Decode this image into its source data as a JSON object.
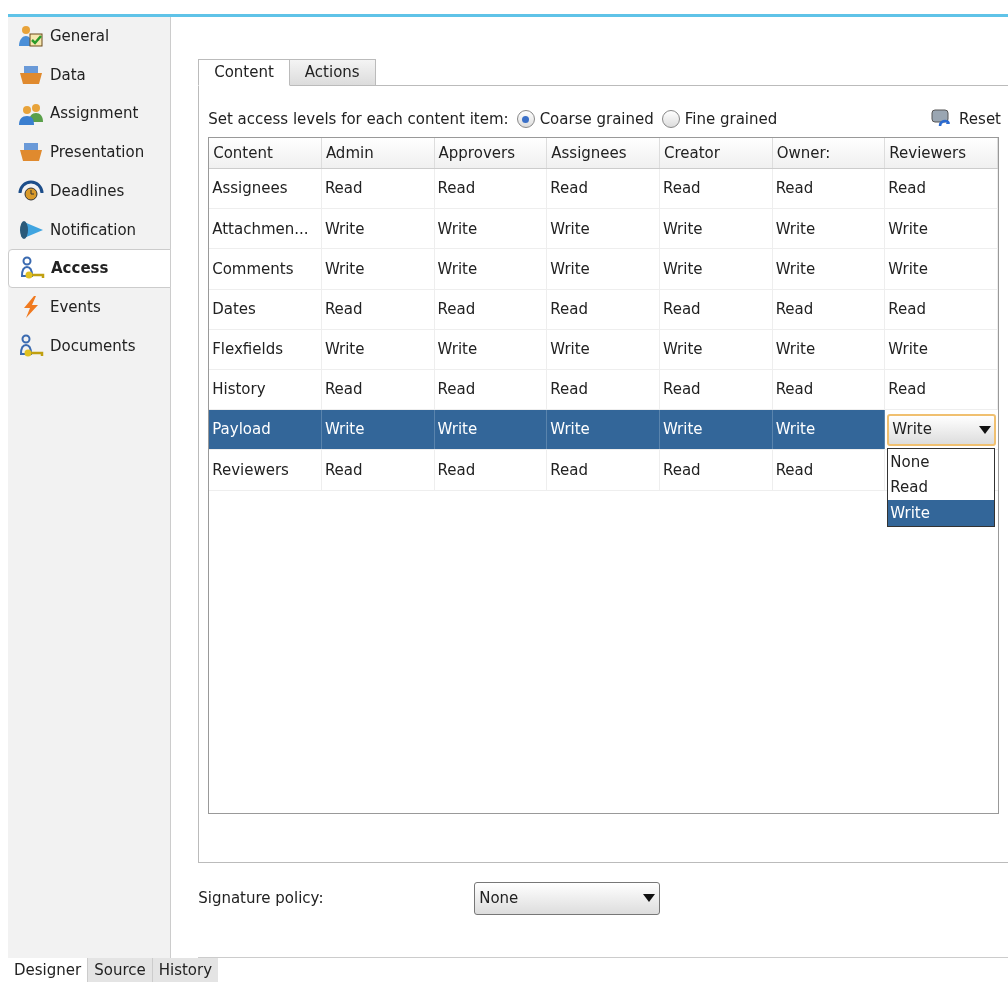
{
  "sidebar": {
    "items": [
      {
        "label": "General",
        "selected": false
      },
      {
        "label": "Data",
        "selected": false
      },
      {
        "label": "Assignment",
        "selected": false
      },
      {
        "label": "Presentation",
        "selected": false
      },
      {
        "label": "Deadlines",
        "selected": false
      },
      {
        "label": "Notification",
        "selected": false
      },
      {
        "label": "Access",
        "selected": true
      },
      {
        "label": "Events",
        "selected": false
      },
      {
        "label": "Documents",
        "selected": false
      }
    ]
  },
  "tabs": [
    {
      "label": "Content",
      "selected": true
    },
    {
      "label": "Actions",
      "selected": false
    }
  ],
  "access_levels": {
    "label": "Set access levels for each content item:",
    "options": [
      {
        "label": "Coarse grained",
        "selected": true
      },
      {
        "label": "Fine grained",
        "selected": false
      }
    ]
  },
  "reset_button": "Reset",
  "table": {
    "columns": [
      "Content",
      "Admin",
      "Approvers",
      "Assignees",
      "Creator",
      "Owner:",
      "Reviewers"
    ],
    "rows": [
      {
        "selected": false,
        "cells": [
          "Assignees",
          "Read",
          "Read",
          "Read",
          "Read",
          "Read",
          "Read"
        ]
      },
      {
        "selected": false,
        "cells": [
          "Attachmen...",
          "Write",
          "Write",
          "Write",
          "Write",
          "Write",
          "Write"
        ]
      },
      {
        "selected": false,
        "cells": [
          "Comments",
          "Write",
          "Write",
          "Write",
          "Write",
          "Write",
          "Write"
        ]
      },
      {
        "selected": false,
        "cells": [
          "Dates",
          "Read",
          "Read",
          "Read",
          "Read",
          "Read",
          "Read"
        ]
      },
      {
        "selected": false,
        "cells": [
          "Flexfields",
          "Write",
          "Write",
          "Write",
          "Write",
          "Write",
          "Write"
        ]
      },
      {
        "selected": false,
        "cells": [
          "History",
          "Read",
          "Read",
          "Read",
          "Read",
          "Read",
          "Read"
        ]
      },
      {
        "selected": true,
        "cells": [
          "Payload",
          "Write",
          "Write",
          "Write",
          "Write",
          "Write"
        ],
        "editor": {
          "value": "Write",
          "options": [
            {
              "label": "None",
              "selected": false
            },
            {
              "label": "Read",
              "selected": false
            },
            {
              "label": "Write",
              "selected": true
            }
          ]
        }
      },
      {
        "selected": false,
        "cells": [
          "Reviewers",
          "Read",
          "Read",
          "Read",
          "Read",
          "Read"
        ]
      }
    ]
  },
  "signature_policy": {
    "label": "Signature policy:",
    "value": "None"
  },
  "bottom_tabs": [
    {
      "label": "Designer",
      "selected": true
    },
    {
      "label": "Source",
      "selected": false
    },
    {
      "label": "History",
      "selected": false
    }
  ]
}
